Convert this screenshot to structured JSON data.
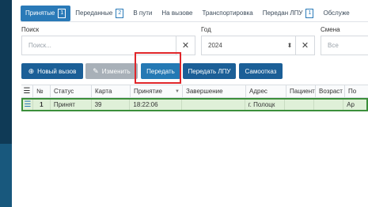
{
  "tabs": [
    {
      "label": "Принятые",
      "badge": "1",
      "active": true
    },
    {
      "label": "Переданные",
      "badge": "2"
    },
    {
      "label": "В пути"
    },
    {
      "label": "На вызове"
    },
    {
      "label": "Транспортировка"
    },
    {
      "label": "Передан ЛПУ",
      "badge": "1"
    },
    {
      "label": "Обслуже"
    }
  ],
  "filters": {
    "search_label": "Поиск",
    "search_placeholder": "Поиск...",
    "year_label": "Год",
    "year_value": "2024",
    "shift_label": "Смена",
    "shift_value": "Все"
  },
  "toolbar": {
    "new_call": "Новый вызов",
    "edit": "Изменить",
    "transfer": "Передать",
    "transfer_lpu": "Передать ЛПУ",
    "self_refusal": "Самоотказ"
  },
  "table": {
    "columns": [
      "№",
      "Статус",
      "Карта",
      "Принятие",
      "Завершение",
      "Адрес",
      "Пациент",
      "Возраст",
      "По"
    ],
    "rows": [
      {
        "num": "1",
        "status": "Принят",
        "card": "39",
        "accepted": "18:22:06",
        "finished": "",
        "address": "г. Полоцк",
        "patient": "",
        "age": "",
        "extra": "Ар"
      }
    ]
  },
  "icons": {
    "menu": "menu-icon",
    "plus": "plus-circle-icon",
    "edit": "edit-icon",
    "clear": "close-icon",
    "spin": "spinner-arrows-icon"
  },
  "colors": {
    "primary": "#1b5f97",
    "highlight": "#e0262a",
    "row_selected": "#dff0d8",
    "rail": "#0f3a56"
  }
}
